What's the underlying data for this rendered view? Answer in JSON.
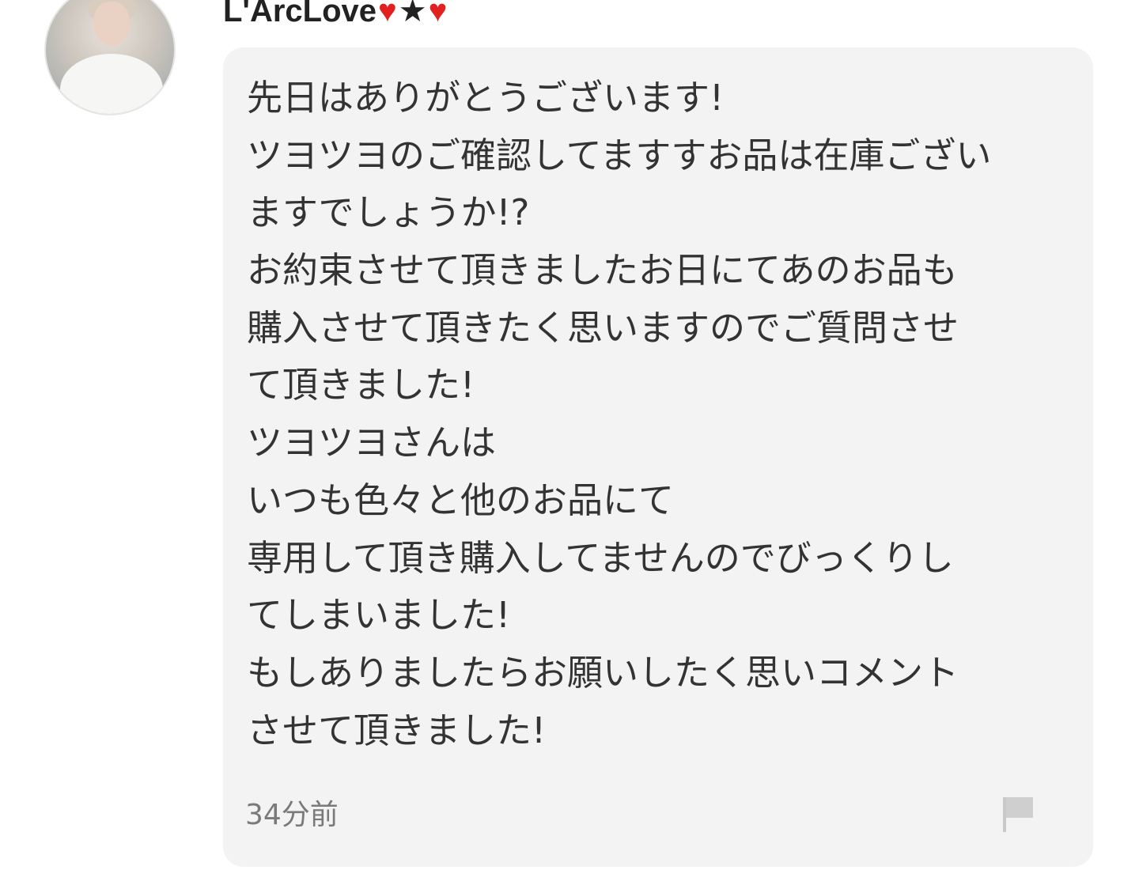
{
  "comment": {
    "username": "L'ArcLove",
    "name_symbols": [
      {
        "char": "♥",
        "color": "#e32020"
      },
      {
        "char": "★",
        "color": "#222222"
      },
      {
        "char": "♥",
        "color": "#e32020"
      }
    ],
    "avatar_icon": "user-avatar",
    "message_lines": [
      "先日はありがとうございます!",
      "ツヨツヨのご確認してますすお品は在庫ござい",
      "ますでしょうか!?",
      "お約束させて頂きましたお日にてあのお品も",
      "購入させて頂きたく思いますのでご質問させ",
      "て頂きました!",
      "ツヨツヨさんは",
      "いつも色々と他のお品にて",
      "専用して頂き購入してませんのでびっくりし",
      "てしまいました!",
      "もしありましたらお願いしたく思いコメント",
      "させて頂きました!"
    ],
    "timestamp": "34分前",
    "report_icon": "flag-icon",
    "bubble_color": "#f3f3f3",
    "text_color": "#333333"
  }
}
